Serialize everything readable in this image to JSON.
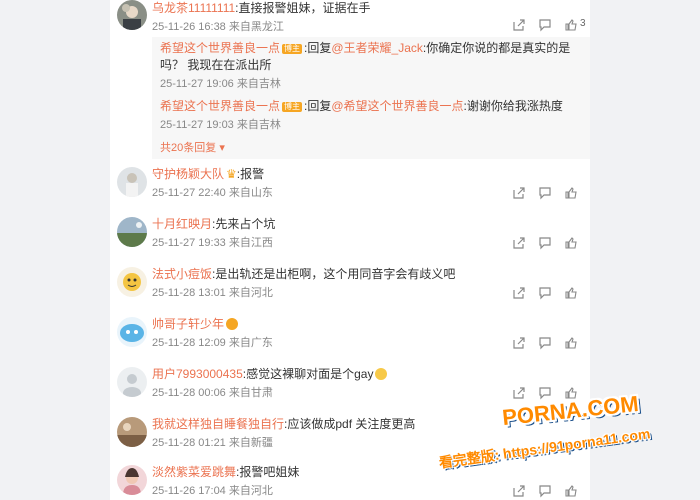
{
  "colors": {
    "username": "#eb7350",
    "text": "#333333",
    "meta": "#888888",
    "watermark": "#ff8a00"
  },
  "comments": [
    {
      "user": "乌龙茶11111111",
      "sep": ":",
      "text": "直接报警姐妹，证据在手",
      "time": "25-11-26 16:38",
      "loc": "来自黑龙江",
      "likes": "3",
      "avatar_icon": "avatar-icon"
    },
    {
      "user": "守护杨颖大队",
      "sep": ":",
      "text": "报警",
      "time": "25-11-27 22:40",
      "loc": "来自山东"
    },
    {
      "user": "十月红映月",
      "sep": ":",
      "text": "先来占个坑",
      "time": "25-11-27 19:33",
      "loc": "来自江西"
    },
    {
      "user": "法式小痘饭",
      "sep": ":",
      "text": "是出轨还是出柜啊，这个用同音字会有歧义吧",
      "time": "25-11-28 13:01",
      "loc": "来自河北"
    },
    {
      "user": "帅哥子轩少年",
      "sep": "",
      "text": "",
      "time": "25-11-28 12:09",
      "loc": "来自广东"
    },
    {
      "user": "用户7993000435",
      "sep": ":",
      "text": "感觉这裸聊对面是个gay",
      "time": "25-11-28 00:06",
      "loc": "来自甘肃"
    },
    {
      "user": "我就这样独自睡餐独自行",
      "sep": ":",
      "text": "应该做成pdf 关注度更高",
      "time": "25-11-28 01:21",
      "loc": "来自新疆"
    },
    {
      "user": "淡然紫菜爱跳舞",
      "sep": ":",
      "text": "报警吧姐妹",
      "time": "25-11-26 17:04",
      "loc": "来自河北"
    }
  ],
  "replies": [
    {
      "user": "希望这个世界善良一点",
      "tag": "博主",
      "prefix": ":回复",
      "target": "@王者荣耀_Jack",
      "text": ":你确定你说的都是真实的是吗？ 我现在在派出所",
      "time": "25-11-27 19:06",
      "loc": "来自吉林"
    },
    {
      "user": "希望这个世界善良一点",
      "tag": "博主",
      "prefix": ":回复",
      "target": "@希望这个世界善良一点",
      "text": ":谢谢你给我涨热度",
      "time": "25-11-27 19:03",
      "loc": "来自吉林"
    }
  ],
  "more_replies": "共20条回复",
  "watermark": {
    "line1": "PORNA.COM",
    "line2": "看完整版: https://91porna11.com"
  }
}
